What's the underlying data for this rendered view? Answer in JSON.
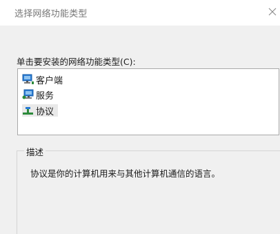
{
  "window": {
    "title": "选择网络功能类型",
    "close_icon": "close-icon"
  },
  "prompt": "单击要安装的网络功能类型(C):",
  "list": {
    "items": [
      {
        "label": "客户端",
        "icon": "network-client-icon",
        "selected": false
      },
      {
        "label": "服务",
        "icon": "network-service-icon",
        "selected": false
      },
      {
        "label": "协议",
        "icon": "network-protocol-icon",
        "selected": true
      }
    ]
  },
  "description": {
    "legend": "描述",
    "text": "协议是你的计算机用来与其他计算机通信的语言。"
  },
  "colors": {
    "monitor_blue": "#2a7bd4",
    "network_green": "#2c8a3a",
    "background": "#f0f0f0"
  }
}
